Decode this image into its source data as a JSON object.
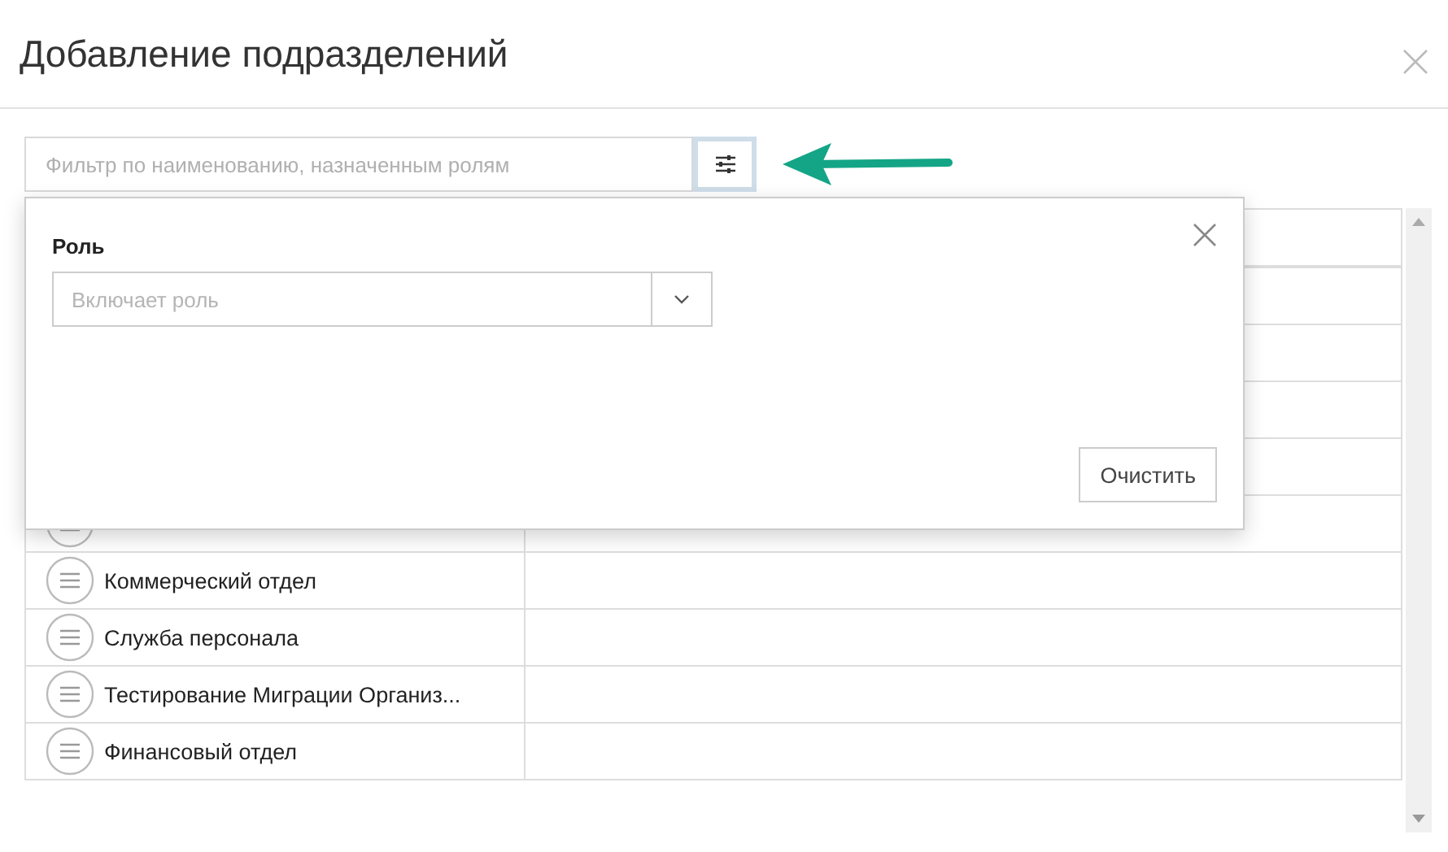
{
  "dialog": {
    "title": "Добавление подразделений"
  },
  "filter": {
    "placeholder": "Фильтр по наименованию, назначенным ролям",
    "filter_button_active": true
  },
  "popover": {
    "role_label": "Роль",
    "role_select": {
      "placeholder": "Включает роль"
    },
    "clear_button": "Очистить"
  },
  "table": {
    "rows": [
      {
        "name": "Коммерческий отдел"
      },
      {
        "name": "Служба персонала"
      },
      {
        "name": "Тестирование Миграции Организ..."
      },
      {
        "name": "Финансовый отдел"
      }
    ]
  }
}
